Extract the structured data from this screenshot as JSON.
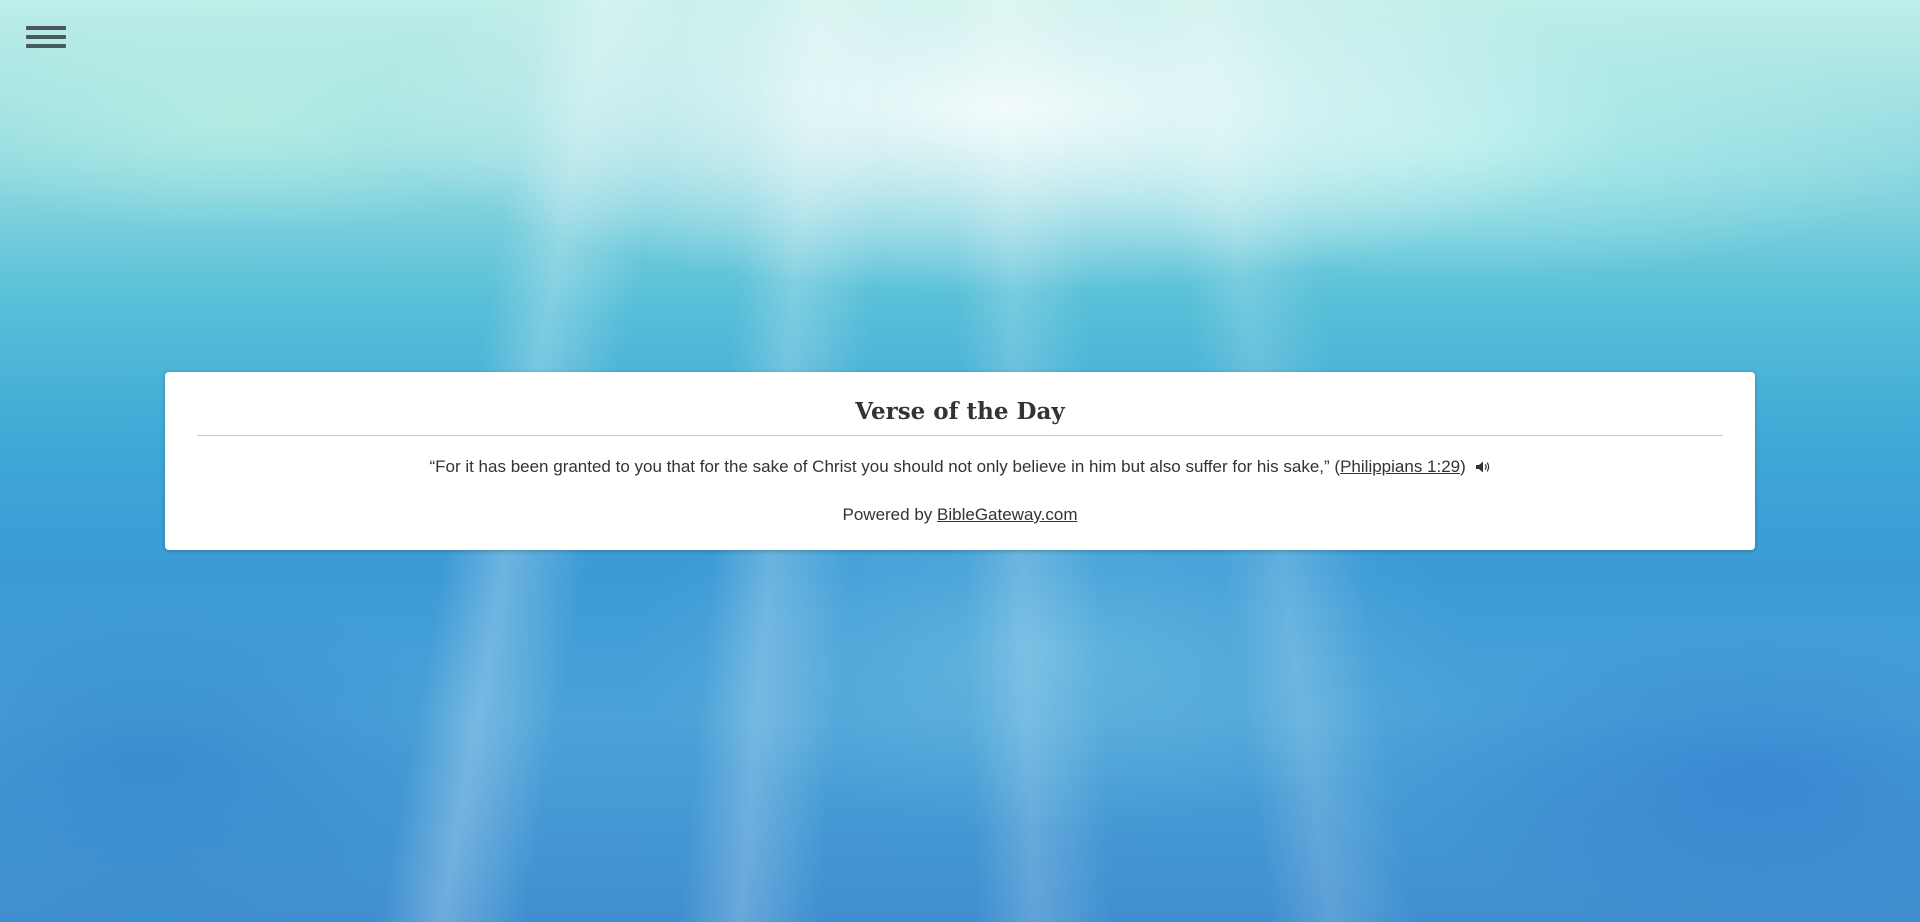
{
  "menu": {
    "icon": "hamburger-menu-icon"
  },
  "verse_card": {
    "title": "Verse of the Day",
    "verse_text": "“For it has been granted to you that for the sake of Christ you should not only believe in him but also suffer for his sake,”",
    "reference_open": "(",
    "reference_link": "Philippians 1:29",
    "reference_close": ")",
    "audio_icon": "speaker-audio-icon",
    "powered_prefix": "Powered by",
    "powered_link": "BibleGateway.com"
  },
  "colors": {
    "card_background": "#ffffff",
    "text": "#333333",
    "menu_icon": "#4a5a5c"
  }
}
